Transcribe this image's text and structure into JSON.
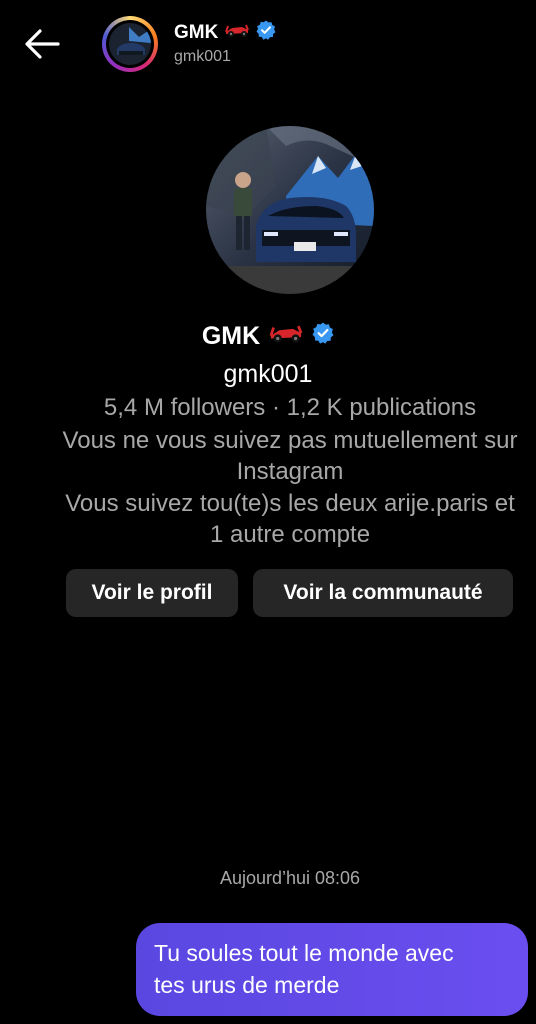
{
  "header": {
    "name": "GMK",
    "username": "gmk001"
  },
  "profile": {
    "name": "GMK",
    "username": "gmk001",
    "stats": "5,4 M followers · 1,2 K publications",
    "mutual_line1": "Vous ne vous suivez pas mutuellement sur",
    "mutual_line2": "Instagram",
    "follow_line1": "Vous suivez tou(te)s les deux arije.paris et",
    "follow_line2": "1 autre compte"
  },
  "buttons": {
    "view_profile": "Voir le profil",
    "view_community": "Voir la communauté"
  },
  "chat": {
    "timestamp": "Aujourd’hui 08:06",
    "messages": [
      {
        "text_line1": "Tu soules tout le monde avec",
        "text_line2": "tes urus de merde"
      }
    ]
  },
  "colors": {
    "background": "#000000",
    "bubble": "#6149ea",
    "verified": "#3897f0",
    "button": "#262626"
  },
  "icons": {
    "back": "back-arrow-icon",
    "verified": "verified-badge-icon",
    "emoji": "race-car-emoji"
  }
}
